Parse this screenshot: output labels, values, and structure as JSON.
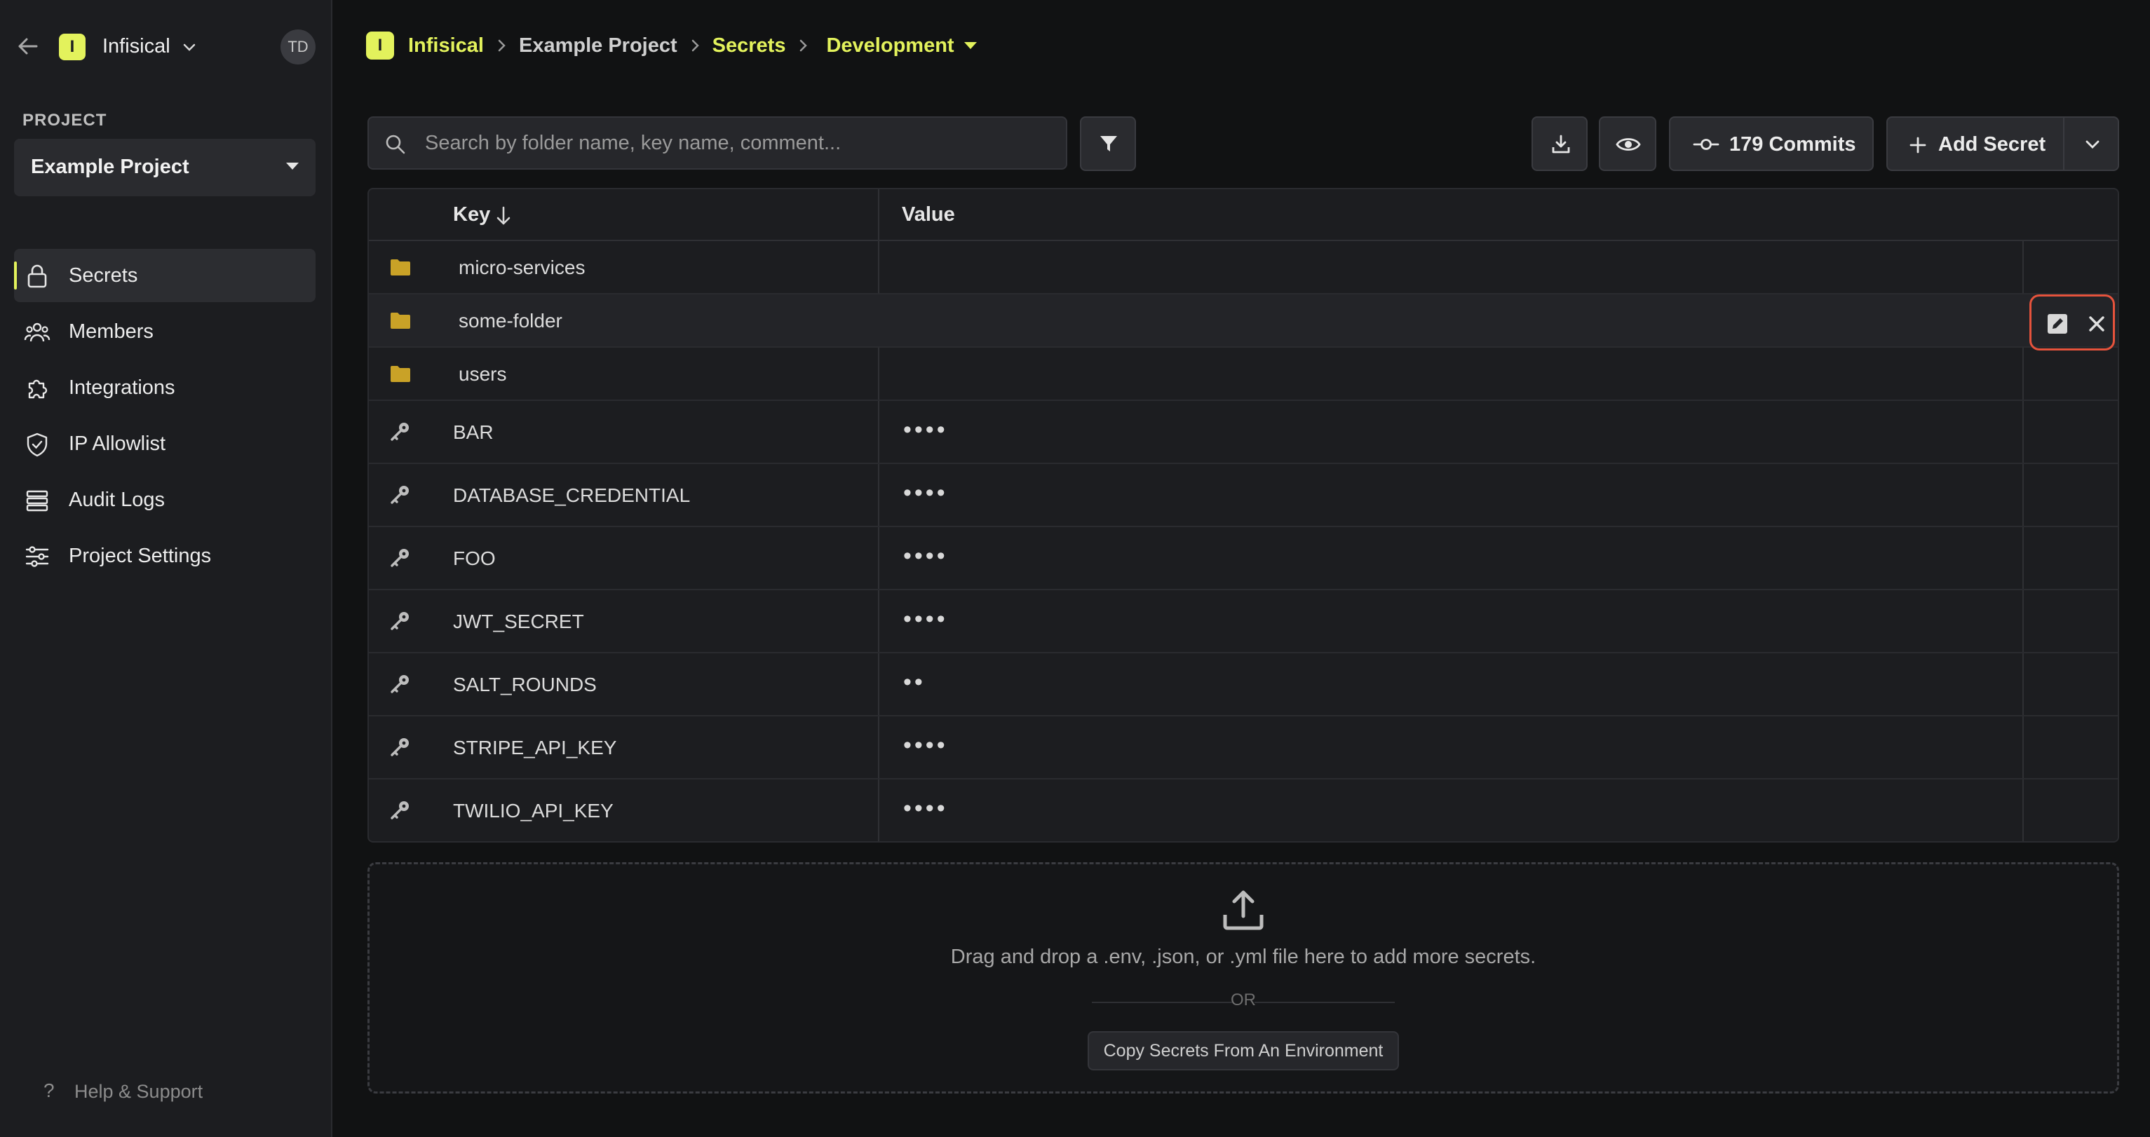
{
  "sidebar": {
    "org_name": "Infisical",
    "org_logo_letter": "I",
    "avatar_initials": "TD",
    "project_label": "PROJECT",
    "project_selected": "Example Project",
    "nav": [
      {
        "label": "Secrets",
        "icon": "lock-icon",
        "active": true
      },
      {
        "label": "Members",
        "icon": "users-icon",
        "active": false
      },
      {
        "label": "Integrations",
        "icon": "puzzle-icon",
        "active": false
      },
      {
        "label": "IP Allowlist",
        "icon": "shield-icon",
        "active": false
      },
      {
        "label": "Audit Logs",
        "icon": "list-icon",
        "active": false
      },
      {
        "label": "Project Settings",
        "icon": "sliders-icon",
        "active": false
      }
    ],
    "help_label": "Help & Support"
  },
  "breadcrumb": {
    "logo_letter": "I",
    "org": "Infisical",
    "project": "Example Project",
    "section": "Secrets",
    "environment": "Development"
  },
  "toolbar": {
    "search_placeholder": "Search by folder name, key name, comment...",
    "commits_label": "179 Commits",
    "add_secret_label": "Add Secret"
  },
  "table": {
    "headers": {
      "key": "Key",
      "value": "Value"
    },
    "folders": [
      "micro-services",
      "some-folder",
      "users"
    ],
    "secrets": [
      {
        "key": "BAR",
        "value": "••••"
      },
      {
        "key": "DATABASE_CREDENTIAL",
        "value": "••••"
      },
      {
        "key": "FOO",
        "value": "••••"
      },
      {
        "key": "JWT_SECRET",
        "value": "••••"
      },
      {
        "key": "SALT_ROUNDS",
        "value": "••"
      },
      {
        "key": "STRIPE_API_KEY",
        "value": "••••"
      },
      {
        "key": "TWILIO_API_KEY",
        "value": "••••"
      }
    ]
  },
  "dropzone": {
    "text": "Drag and drop a .env, .json, or .yml file here to add more secrets.",
    "or": "OR",
    "copy_button": "Copy Secrets From An Environment"
  },
  "colors": {
    "accent": "#e3f25c",
    "folder": "#c9a227",
    "highlight": "#e5533c"
  }
}
